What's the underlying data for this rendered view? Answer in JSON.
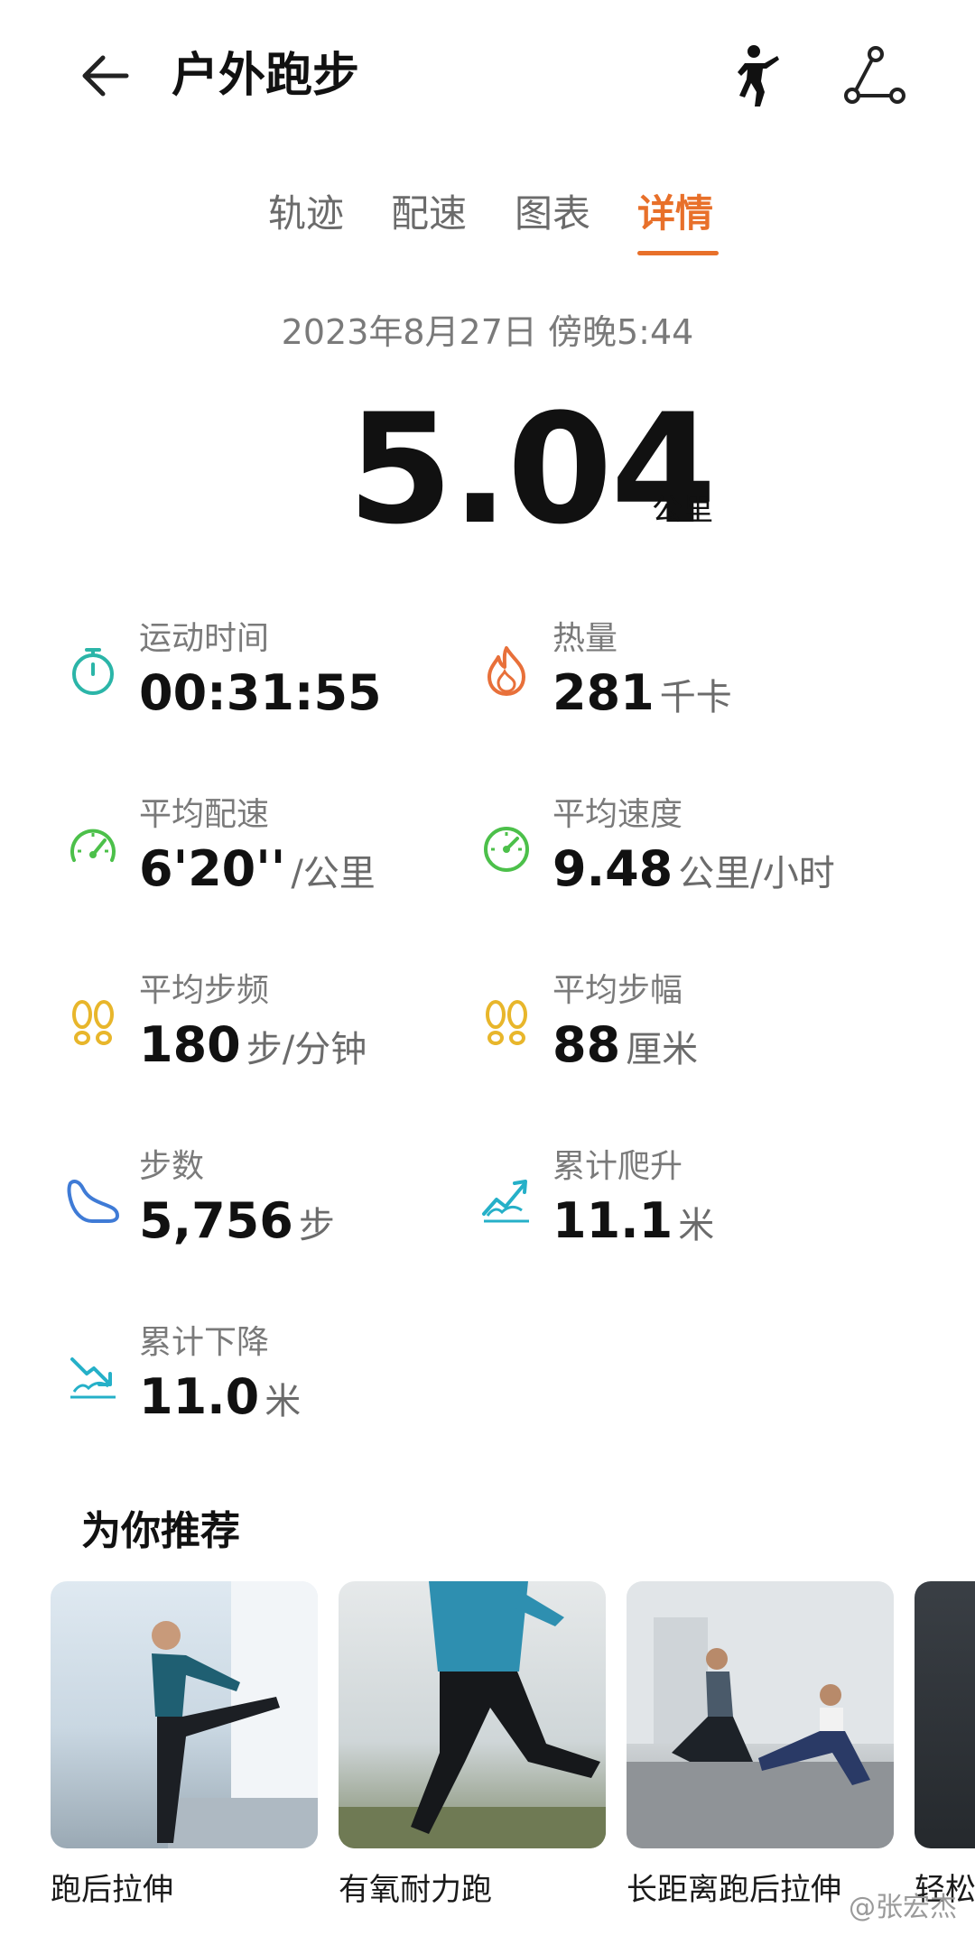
{
  "header": {
    "title": "户外跑步"
  },
  "tabs": [
    {
      "label": "轨迹"
    },
    {
      "label": "配速"
    },
    {
      "label": "图表"
    },
    {
      "label": "详情"
    }
  ],
  "active_tab": "详情",
  "summary": {
    "datetime": "2023年8月27日 傍晚5:44",
    "distance": "5.04",
    "distance_unit": "公里"
  },
  "stats": {
    "duration": {
      "label": "运动时间",
      "value": "00:31:55",
      "unit": ""
    },
    "calories": {
      "label": "热量",
      "value": "281",
      "unit": "千卡"
    },
    "avg_pace": {
      "label": "平均配速",
      "value": "6'20''",
      "unit": "/公里"
    },
    "avg_speed": {
      "label": "平均速度",
      "value": "9.48",
      "unit": "公里/小时"
    },
    "cadence": {
      "label": "平均步频",
      "value": "180",
      "unit": "步/分钟"
    },
    "stride": {
      "label": "平均步幅",
      "value": "88",
      "unit": "厘米"
    },
    "steps": {
      "label": "步数",
      "value": "5,756",
      "unit": "步"
    },
    "ascent": {
      "label": "累计爬升",
      "value": "11.1",
      "unit": "米"
    },
    "descent": {
      "label": "累计下降",
      "value": "11.0",
      "unit": "米"
    }
  },
  "recommend": {
    "title": "为你推荐",
    "items": [
      {
        "label": "跑后拉伸"
      },
      {
        "label": "有氧耐力跑"
      },
      {
        "label": "长距离跑后拉伸"
      },
      {
        "label": "轻松"
      }
    ]
  },
  "watermark": "@张宏杰",
  "colors": {
    "accent": "#e8702a",
    "teal": "#2bb5a8",
    "green": "#4cc04a",
    "yellow": "#e8b62b",
    "blue": "#3f7bd6",
    "cyan": "#25b0c8",
    "orange": "#e8703a"
  }
}
